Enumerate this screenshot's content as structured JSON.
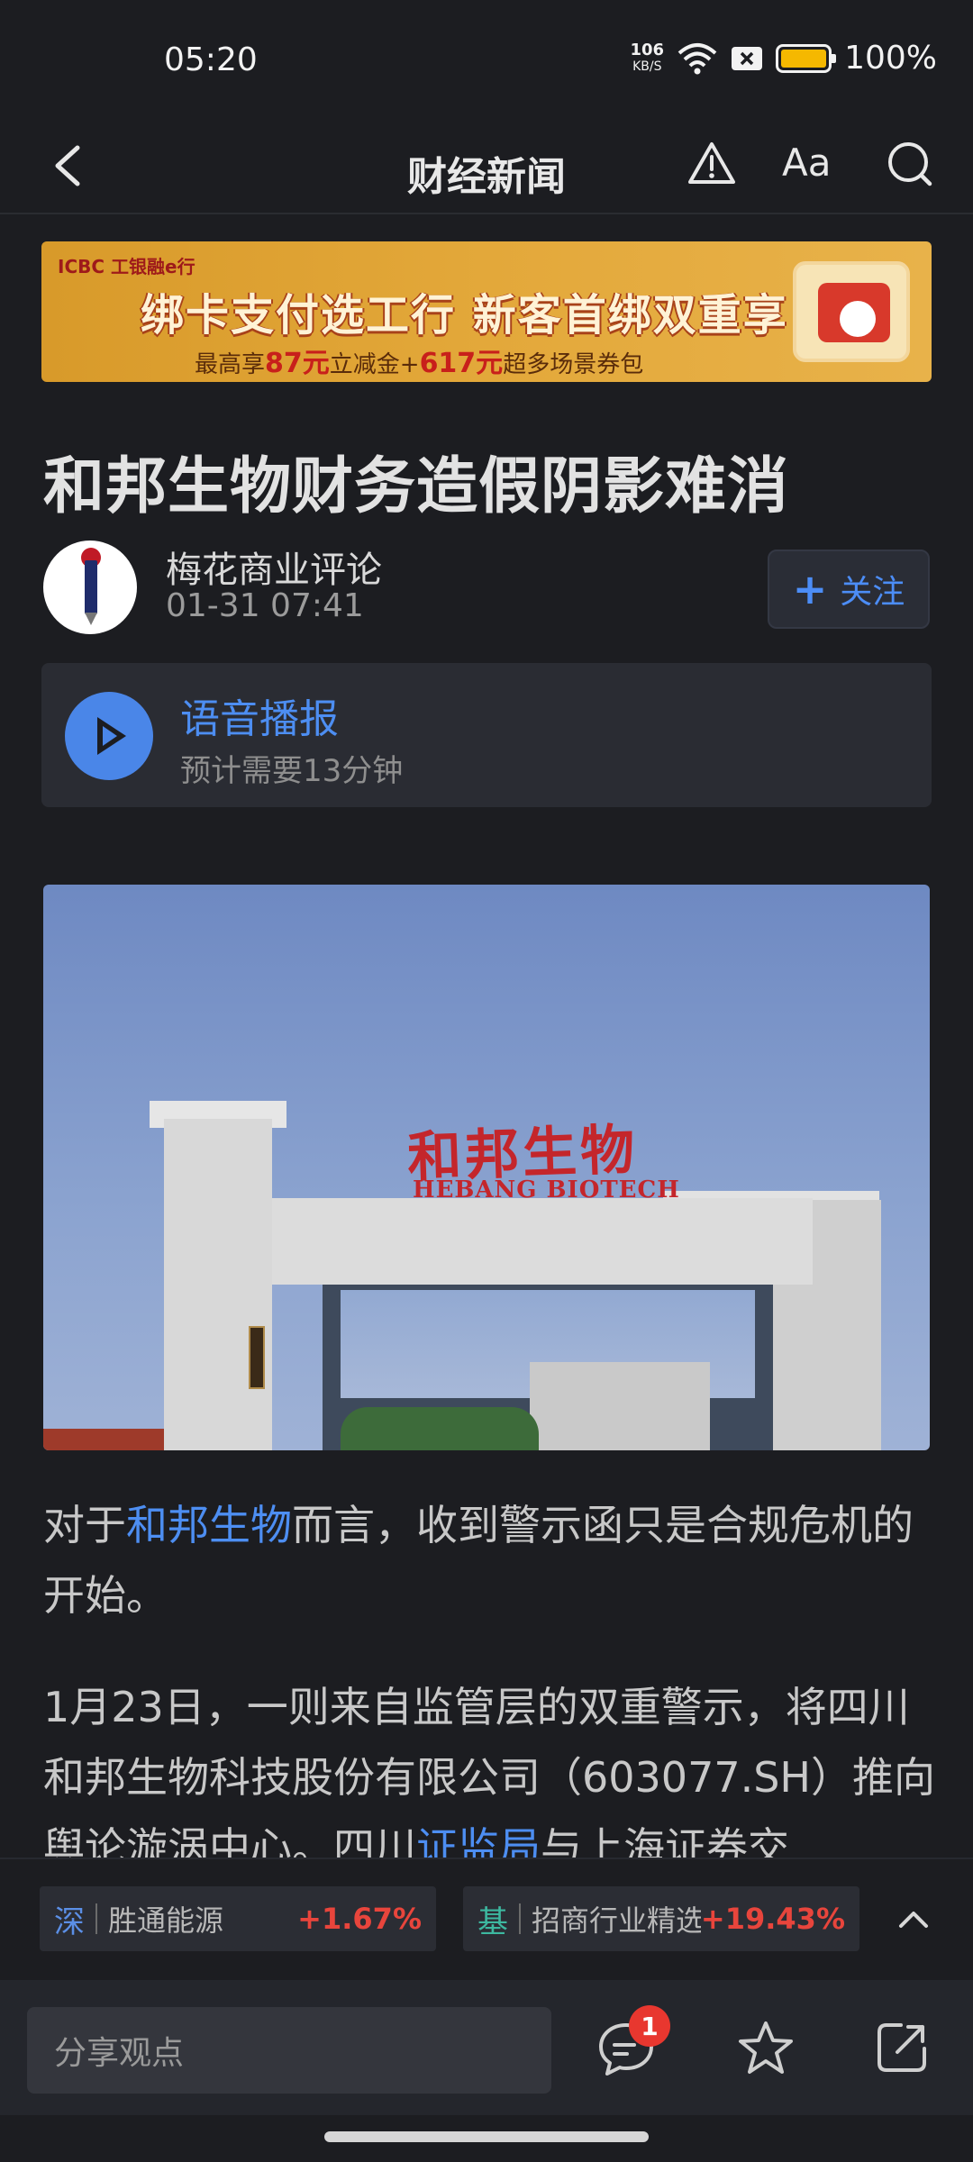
{
  "status_bar": {
    "time": "05:20",
    "net_speed_value": "106",
    "net_speed_unit": "KB/S",
    "battery_percent": "100%",
    "battery_level": 1.0
  },
  "nav": {
    "title": "财经新闻",
    "font_label": "Aa"
  },
  "banner": {
    "logo_text": "ICBC 工银融e行",
    "main_text": "绑卡支付选工行  新客首绑双重享",
    "sub_prefix": "最高享",
    "sub_amount1": "87元",
    "sub_mid": "立减金+",
    "sub_amount2": "617元",
    "sub_suffix": "超多场景券包"
  },
  "article": {
    "title": "和邦生物财务造假阴影难消",
    "author": "梅花商业评论",
    "time": "01-31 07:41",
    "follow_label": "关注",
    "voice_title": "语音播报",
    "voice_sub": "预计需要13分钟",
    "photo_sign_cn": "和邦生物",
    "photo_sign_en": "HEBANG BIOTECH",
    "p1_a": "对于",
    "p1_link": "和邦生物",
    "p1_b": "而言，收到警示函只是合规危机的开始。",
    "p2_a": "1月23日，一则来自监管层的双重警示，将四川和邦生物科技股份有限公司（603077.SH）推向舆论漩涡中心。四川",
    "p2_link": "证监局",
    "p2_b": "与上海证券交"
  },
  "tickers": [
    {
      "tag": "深",
      "name": "胜通能源",
      "change": "+1.67%"
    },
    {
      "tag": "基",
      "name": "招商行业精选...",
      "change": "+19.43%"
    }
  ],
  "bottom": {
    "comment_placeholder": "分享观点",
    "comment_count": "1"
  }
}
